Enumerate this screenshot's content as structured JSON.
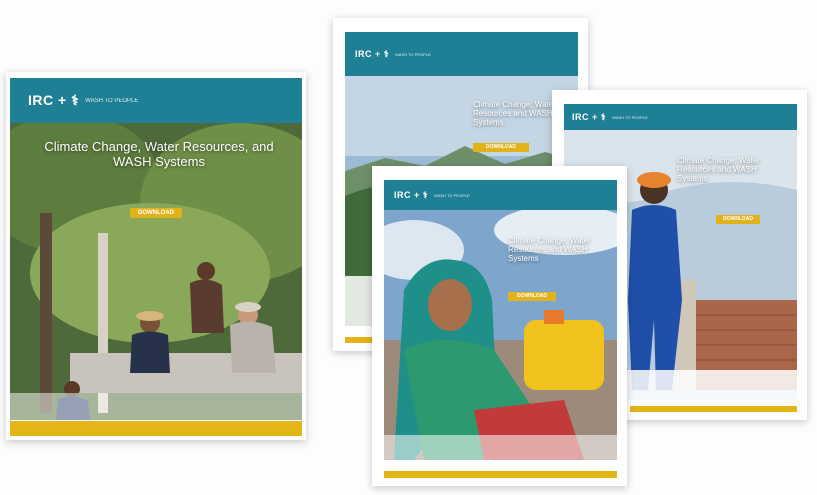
{
  "colors": {
    "header": "#1f7f94",
    "accent": "#e0b21c",
    "bar": "#e3b517"
  },
  "cards": [
    {
      "logo": "IRC + ⚕",
      "logo_sub": "WASH TO PEOPLE",
      "title": "Climate Change, Water Resources, and WASH Systems",
      "subtitle": "",
      "pill": "DOWNLOAD"
    },
    {
      "logo": "IRC + ⚕",
      "logo_sub": "WASH TO PEOPLE",
      "title": "Climate Change, Water Resources and WASH Systems",
      "pill": "DOWNLOAD"
    },
    {
      "logo": "IRC + ⚕",
      "logo_sub": "WASH TO PEOPLE",
      "title": "Climate Change, Water Resources and WASH Systems",
      "pill": "DOWNLOAD"
    },
    {
      "logo": "IRC + ⚕",
      "logo_sub": "WASH TO PEOPLE",
      "title": "Climate Change, Water Resources and WASH Systems",
      "pill": "DOWNLOAD"
    }
  ]
}
